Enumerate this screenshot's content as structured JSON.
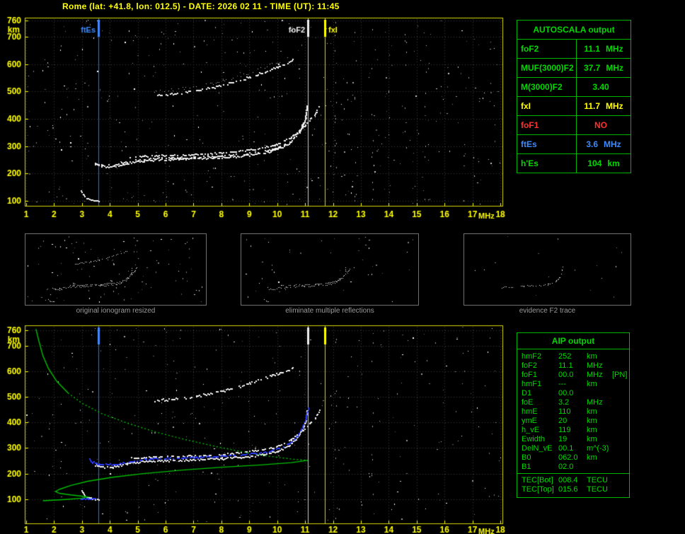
{
  "title": "Rome (lat: +41.8, lon: 012.5) - DATE: 2026 02 11 - TIME (UT): 11:45",
  "colors": {
    "axis": "#ffff00",
    "table_green": "#00d800",
    "table_border": "#00b400",
    "marker_blue": "#3d8bff",
    "marker_white": "#f0f0f0",
    "marker_yellow": "#ffff00",
    "trace_white": "#f2f2f2",
    "autoscaled_blue": "#2b3cff",
    "profile_green": "#00c000",
    "caption_gray": "#9a9a9a"
  },
  "autoscala": {
    "header": "AUTOSCALA output",
    "rows": [
      {
        "label": "foF2",
        "value": "11.1",
        "unit": "MHz",
        "color": "green"
      },
      {
        "label": "MUF(3000)F2",
        "value": "37.7",
        "unit": "MHz",
        "color": "green"
      },
      {
        "label": "M(3000)F2",
        "value": "3.40",
        "unit": "",
        "color": "green"
      },
      {
        "label": "fxI",
        "value": "11.7",
        "unit": "MHz",
        "color": "yellow"
      },
      {
        "label": "foF1",
        "value": "NO",
        "unit": "",
        "color": "red"
      },
      {
        "label": "ftEs",
        "value": "3.6",
        "unit": "MHz",
        "color": "blue"
      },
      {
        "label": "h'Es",
        "value": "104",
        "unit": "km",
        "color": "green"
      }
    ]
  },
  "aip": {
    "header": "AIP output",
    "rows": [
      {
        "name": "hmF2",
        "value": "252",
        "unit": "km",
        "extra": ""
      },
      {
        "name": "foF2",
        "value": "11.1",
        "unit": "MHz",
        "extra": ""
      },
      {
        "name": "foF1",
        "value": "00.0",
        "unit": "MHz",
        "extra": "[PN]"
      },
      {
        "name": "hmF1",
        "value": "---",
        "unit": "km",
        "extra": ""
      },
      {
        "name": "D1",
        "value": "00.0",
        "unit": "",
        "extra": ""
      },
      {
        "name": "foE",
        "value": "3.2",
        "unit": "MHz",
        "extra": ""
      },
      {
        "name": "hmE",
        "value": "110",
        "unit": "km",
        "extra": ""
      },
      {
        "name": "ymE",
        "value": "20",
        "unit": "km",
        "extra": ""
      },
      {
        "name": "h_vE",
        "value": "119",
        "unit": "km",
        "extra": ""
      },
      {
        "name": "Ewidth",
        "value": "19",
        "unit": "km",
        "extra": ""
      },
      {
        "name": "DelN_vE",
        "value": "00.1",
        "unit": "m^(-3)",
        "extra": ""
      },
      {
        "name": "B0",
        "value": "062.0",
        "unit": "km",
        "extra": ""
      },
      {
        "name": "B1",
        "value": "02.0",
        "unit": "",
        "extra": ""
      }
    ],
    "tec_rows": [
      {
        "name": "TEC[Bot]",
        "value": "008.4",
        "unit": "TECU"
      },
      {
        "name": "TEC[Top]",
        "value": "015.6",
        "unit": "TECU"
      }
    ]
  },
  "thumbnails": [
    {
      "caption": "original ionogram resized",
      "variant": "full"
    },
    {
      "caption": "eliminate multiple reflections",
      "variant": "clean"
    },
    {
      "caption": "evidence F2 trace",
      "variant": "f2"
    }
  ],
  "chart_data": [
    {
      "id": "main_ionogram",
      "type": "scatter",
      "xlabel": "MHz",
      "ylabel": "km",
      "x_ticks": [
        1,
        2,
        3,
        4,
        5,
        6,
        7,
        8,
        9,
        10,
        11,
        12,
        13,
        14,
        15,
        16,
        17,
        18
      ],
      "y_ticks": [
        760,
        700,
        600,
        500,
        400,
        300,
        200,
        100
      ],
      "xlim": [
        0.95,
        18.1
      ],
      "ylim": [
        79,
        770
      ],
      "markers": [
        {
          "label": "ftEs",
          "freq_mhz": 3.6,
          "color": "#3d8bff"
        },
        {
          "label": "foF2",
          "freq_mhz": 11.1,
          "color": "#f0f0f0"
        },
        {
          "label": "fxI",
          "freq_mhz": 11.7,
          "color": "#ffff00"
        }
      ],
      "traces": {
        "f2_ordinary": [
          [
            3.45,
            236
          ],
          [
            3.7,
            228
          ],
          [
            4.1,
            227
          ],
          [
            4.6,
            240
          ],
          [
            5.2,
            249
          ],
          [
            6.0,
            253
          ],
          [
            7.0,
            256
          ],
          [
            8.0,
            261
          ],
          [
            8.8,
            267
          ],
          [
            9.5,
            277
          ],
          [
            10.0,
            290
          ],
          [
            10.45,
            315
          ],
          [
            10.8,
            355
          ],
          [
            11.0,
            400
          ],
          [
            11.05,
            445
          ]
        ],
        "f2_extraordinary": [
          [
            4.7,
            263
          ],
          [
            5.5,
            266
          ],
          [
            6.5,
            269
          ],
          [
            7.5,
            273
          ],
          [
            8.4,
            280
          ],
          [
            9.2,
            291
          ],
          [
            9.9,
            305
          ],
          [
            10.5,
            335
          ],
          [
            11.0,
            380
          ],
          [
            11.35,
            420
          ],
          [
            11.5,
            450
          ]
        ],
        "second_hop": [
          [
            5.6,
            487
          ],
          [
            6.3,
            493
          ],
          [
            7.1,
            505
          ],
          [
            7.9,
            521
          ],
          [
            8.7,
            544
          ],
          [
            9.4,
            569
          ],
          [
            10.0,
            592
          ],
          [
            10.55,
            616
          ]
        ],
        "sporadic_e": [
          [
            2.95,
            138
          ],
          [
            3.05,
            122
          ],
          [
            3.15,
            111
          ],
          [
            3.35,
            104
          ],
          [
            3.6,
            101
          ]
        ]
      }
    },
    {
      "id": "restored_ionogram_with_profile",
      "type": "scatter",
      "xlabel": "MHz",
      "ylabel": "km",
      "x_ticks": [
        1,
        2,
        3,
        4,
        5,
        6,
        7,
        8,
        9,
        10,
        11,
        12,
        13,
        14,
        15,
        16,
        17,
        18
      ],
      "y_ticks": [
        760,
        700,
        600,
        500,
        400,
        300,
        200,
        100
      ],
      "xlim": [
        0.95,
        18.1
      ],
      "ylim": [
        3,
        779
      ],
      "markers": [
        {
          "label": "ftEs",
          "freq_mhz": 3.6,
          "color": "#3d8bff"
        },
        {
          "label": "foF2",
          "freq_mhz": 11.1,
          "color": "#f0f0f0"
        },
        {
          "label": "fxI",
          "freq_mhz": 11.7,
          "color": "#ffff00"
        }
      ],
      "profile_green": [
        [
          1.35,
          765
        ],
        [
          1.45,
          720
        ],
        [
          1.6,
          660
        ],
        [
          1.8,
          610
        ],
        [
          2.1,
          560
        ],
        [
          2.5,
          515
        ],
        [
          3.0,
          475
        ],
        [
          3.7,
          435
        ],
        [
          4.6,
          398
        ],
        [
          5.6,
          364
        ],
        [
          6.7,
          333
        ],
        [
          7.8,
          306
        ],
        [
          8.8,
          284
        ],
        [
          9.7,
          268
        ],
        [
          10.6,
          256
        ],
        [
          11.1,
          252
        ],
        [
          10.5,
          243
        ],
        [
          9.4,
          234
        ],
        [
          8.0,
          225
        ],
        [
          6.6,
          214
        ],
        [
          5.2,
          200
        ],
        [
          4.1,
          186
        ],
        [
          3.2,
          170
        ],
        [
          2.6,
          154
        ],
        [
          2.2,
          139
        ],
        [
          2.05,
          130
        ],
        [
          2.2,
          123
        ],
        [
          2.6,
          117
        ],
        [
          3.0,
          112
        ],
        [
          3.2,
          109
        ],
        [
          3.0,
          104
        ],
        [
          2.4,
          99
        ],
        [
          1.6,
          94
        ]
      ],
      "autoscaled_trace": [
        [
          3.25,
          252
        ],
        [
          3.35,
          238
        ],
        [
          3.6,
          231
        ],
        [
          4.1,
          228
        ],
        [
          4.7,
          241
        ],
        [
          5.3,
          250
        ],
        [
          6.1,
          254
        ],
        [
          7.1,
          257
        ],
        [
          8.1,
          262
        ],
        [
          9.0,
          270
        ],
        [
          9.7,
          281
        ],
        [
          10.2,
          297
        ],
        [
          10.6,
          325
        ],
        [
          10.85,
          365
        ],
        [
          11.0,
          405
        ],
        [
          11.1,
          452
        ]
      ],
      "sporadic_e_blue": [
        [
          2.95,
          104
        ],
        [
          3.2,
          104
        ],
        [
          3.45,
          104
        ]
      ],
      "trace_color": "#2b3cff",
      "profile_color": "#00c000"
    }
  ]
}
